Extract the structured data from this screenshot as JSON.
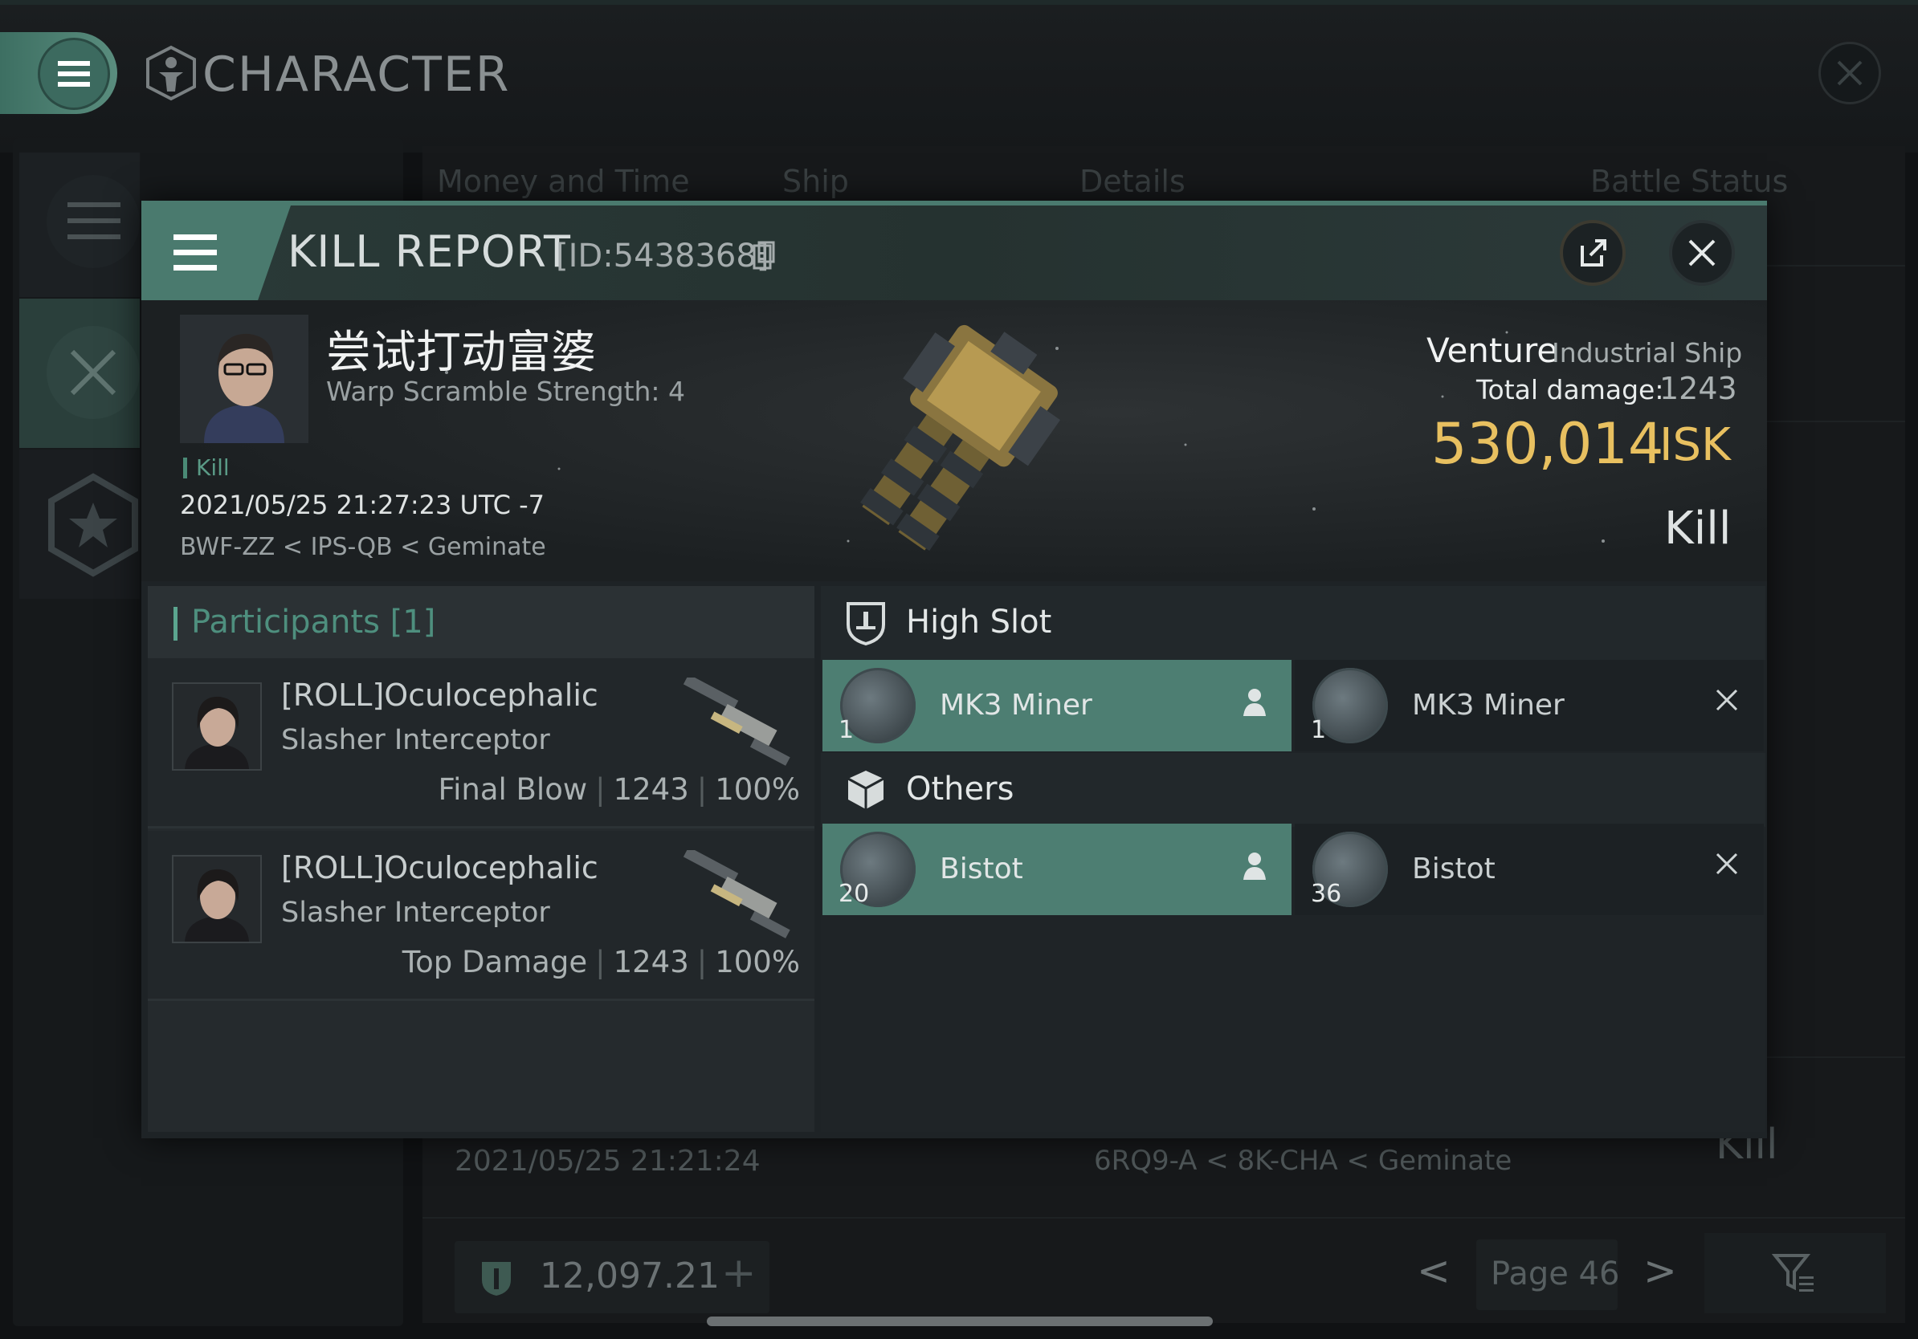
{
  "app": {
    "title": "CHARACTER"
  },
  "background_list": {
    "columns": [
      "Money and Time",
      "Ship",
      "Details",
      "Battle Status"
    ],
    "partial_row": {
      "date": "2021/05/25  21:21:24",
      "route": "6RQ9-A < 8K-CHA < Geminate",
      "result": "Kill"
    },
    "wallet": "12,097.21",
    "page": "Page 46"
  },
  "kill_report": {
    "title": "KILL REPORT",
    "id": "[ID:5438368]",
    "victim": {
      "name": "尝试打动富婆",
      "warp": "Warp Scramble Strength: 4",
      "tag": "Kill",
      "datetime": "2021/05/25 21:27:23 UTC -7",
      "route": "BWF-ZZ < IPS-QB < Geminate"
    },
    "ship": {
      "name": "Venture",
      "class": "Industrial Ship",
      "damage_label": "Total damage:",
      "damage_value": "1243",
      "isk_value": "530,014",
      "isk_unit": "ISK",
      "result": "Kill"
    },
    "participants": {
      "title": "Participants [1]",
      "items": [
        {
          "name": "[ROLL]Oculocephalic",
          "ship": "Slasher Interceptor",
          "label": "Final Blow",
          "damage": "1243",
          "percent": "100%"
        },
        {
          "name": "[ROLL]Oculocephalic",
          "ship": "Slasher Interceptor",
          "label": "Top Damage",
          "damage": "1243",
          "percent": "100%"
        }
      ]
    },
    "fitting": {
      "high_slot": {
        "title": "High Slot",
        "destroyed": {
          "name": "MK3 Miner",
          "qty": "1"
        },
        "dropped": {
          "name": "MK3 Miner",
          "qty": "1"
        }
      },
      "others": {
        "title": "Others",
        "destroyed": {
          "name": "Bistot",
          "qty": "20"
        },
        "dropped": {
          "name": "Bistot",
          "qty": "36"
        }
      }
    }
  },
  "colors": {
    "accent": "#4d7e72",
    "isk": "#e8c060",
    "participants_title": "#4e8f7e"
  }
}
